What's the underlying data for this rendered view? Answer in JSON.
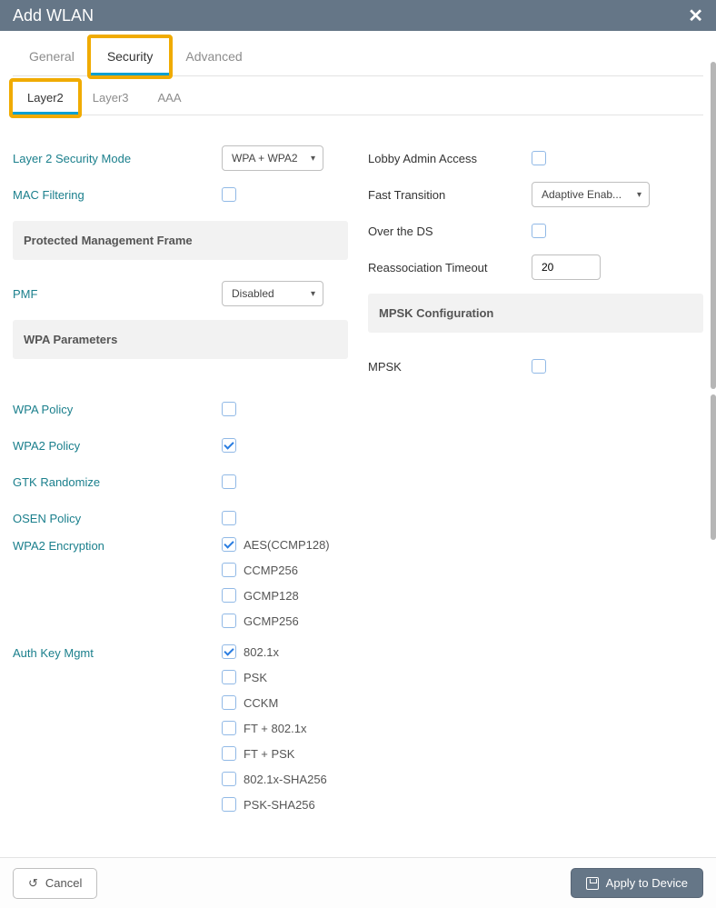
{
  "title": "Add WLAN",
  "tabs": {
    "general": "General",
    "security": "Security",
    "advanced": "Advanced"
  },
  "subtabs": {
    "layer2": "Layer2",
    "layer3": "Layer3",
    "aaa": "AAA"
  },
  "left": {
    "l2mode": {
      "label": "Layer 2 Security Mode",
      "value": "WPA + WPA2"
    },
    "macfiltering": {
      "label": "MAC Filtering"
    },
    "pmf_head": "Protected Management Frame",
    "pmf": {
      "label": "PMF",
      "value": "Disabled"
    },
    "wpa_head": "WPA Parameters",
    "wpa_policy": {
      "label": "WPA Policy"
    },
    "wpa2_policy": {
      "label": "WPA2 Policy"
    },
    "gtk": {
      "label": "GTK Randomize"
    },
    "osen": {
      "label": "OSEN Policy"
    },
    "wpa2_enc": {
      "label": "WPA2 Encryption",
      "opts": [
        "AES(CCMP128)",
        "CCMP256",
        "GCMP128",
        "GCMP256"
      ]
    },
    "auth": {
      "label": "Auth Key Mgmt",
      "opts": [
        "802.1x",
        "PSK",
        "CCKM",
        "FT + 802.1x",
        "FT + PSK",
        "802.1x-SHA256",
        "PSK-SHA256"
      ]
    }
  },
  "right": {
    "lobby": {
      "label": "Lobby Admin Access"
    },
    "ft": {
      "label": "Fast Transition",
      "value": "Adaptive Enab..."
    },
    "ds": {
      "label": "Over the DS"
    },
    "reassoc": {
      "label": "Reassociation Timeout",
      "value": "20"
    },
    "mpsk_head": "MPSK Configuration",
    "mpsk": {
      "label": "MPSK"
    }
  },
  "footer": {
    "cancel": "Cancel",
    "apply": "Apply to Device"
  }
}
